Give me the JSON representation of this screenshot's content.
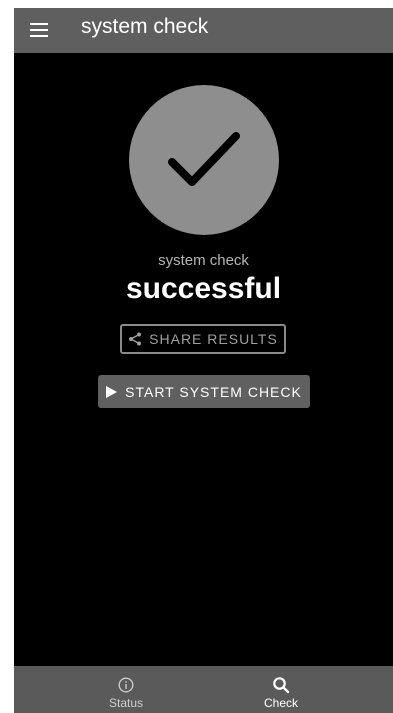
{
  "app_bar": {
    "title": "system check",
    "menu_icon": "hamburger-menu-icon"
  },
  "result": {
    "icon": "checkmark-icon",
    "label": "system check",
    "value": "successful"
  },
  "actions": {
    "share_label": "SHARE RESULTS",
    "share_icon": "share-icon",
    "start_label": "START SYSTEM CHECK",
    "start_icon": "play-icon"
  },
  "bottom_nav": {
    "items": [
      {
        "label": "Status",
        "icon": "info-icon",
        "active": false
      },
      {
        "label": "Check",
        "icon": "search-icon",
        "active": true
      }
    ]
  },
  "colors": {
    "app_bar": "#5f5f5f",
    "background": "#000000",
    "circle": "#8e8e8e",
    "start_button": "#606060",
    "bottom_nav": "#5a5a5a"
  }
}
